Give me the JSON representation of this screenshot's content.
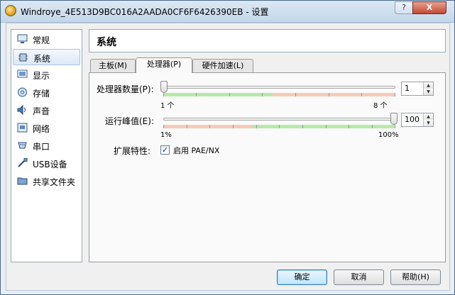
{
  "window": {
    "title": "Windroye_4E513D9BC016A2AADA0CF6F6426390EB - 设置",
    "help_glyph": "?",
    "close_glyph": "X"
  },
  "sidebar": {
    "items": [
      {
        "label": "常规",
        "icon": "monitor-icon"
      },
      {
        "label": "系统",
        "icon": "chip-icon"
      },
      {
        "label": "显示",
        "icon": "display-icon"
      },
      {
        "label": "存储",
        "icon": "disk-icon"
      },
      {
        "label": "声音",
        "icon": "speaker-icon"
      },
      {
        "label": "网络",
        "icon": "network-icon"
      },
      {
        "label": "串口",
        "icon": "serial-port-icon"
      },
      {
        "label": "USB设备",
        "icon": "usb-icon"
      },
      {
        "label": "共享文件夹",
        "icon": "folder-icon"
      }
    ],
    "selected_index": 1
  },
  "header": {
    "title": "系统"
  },
  "tabs": [
    {
      "label": "主板(M)"
    },
    {
      "label": "处理器(P)"
    },
    {
      "label": "硬件加速(L)"
    }
  ],
  "active_tab": 1,
  "processor": {
    "cpu_label": "处理器数量(P):",
    "cpu_value": "1",
    "cpu_min_label": "1 个",
    "cpu_max_label": "8 个",
    "cap_label": "运行峰值(E):",
    "cap_value": "100",
    "cap_min_label": "1%",
    "cap_max_label": "100%",
    "ext_label": "扩展特性:",
    "pae_label": "启用 PAE/NX",
    "pae_checked": true,
    "check_glyph": "✓"
  },
  "buttons": {
    "ok": "确定",
    "cancel": "取消",
    "help": "帮助(H)"
  },
  "colors": {
    "green_range": "#b6eaa6",
    "red_range": "#f7c9b8",
    "selected_bg": "#dbe8f7"
  },
  "spin_glyphs": {
    "up": "▲",
    "down": "▼"
  }
}
